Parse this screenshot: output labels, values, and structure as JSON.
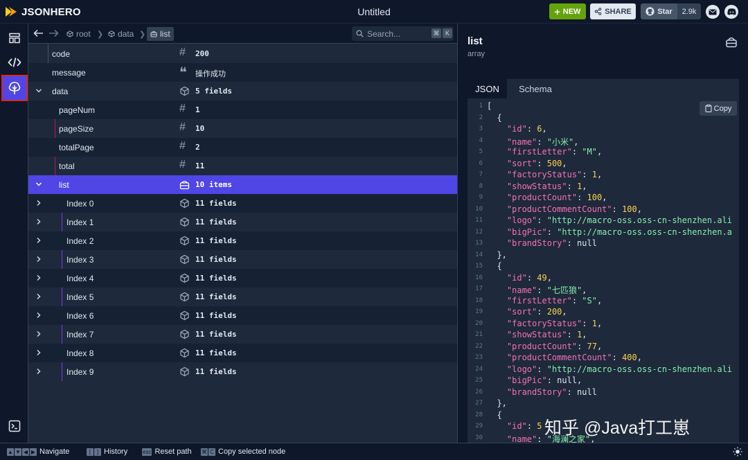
{
  "app": {
    "logo_text": "JSONHERO",
    "document_title": "Untitled",
    "buttons": {
      "new": "NEW",
      "share": "SHARE",
      "star": "Star",
      "star_count": "2.9k"
    }
  },
  "path": {
    "crumbs": [
      {
        "label": "root"
      },
      {
        "label": "data"
      },
      {
        "label": "list"
      }
    ],
    "search_placeholder": "Search...",
    "search_keys": [
      "⌘",
      "K"
    ]
  },
  "tree": {
    "rows": [
      {
        "key": "code",
        "type": "number",
        "value": "200"
      },
      {
        "key": "message",
        "type": "string",
        "value": "操作成功"
      },
      {
        "key": "data",
        "type": "object",
        "value": "5 fields",
        "expanded": true
      },
      {
        "key": "pageNum",
        "type": "number",
        "value": "1"
      },
      {
        "key": "pageSize",
        "type": "number",
        "value": "10"
      },
      {
        "key": "totalPage",
        "type": "number",
        "value": "2"
      },
      {
        "key": "total",
        "type": "number",
        "value": "11"
      },
      {
        "key": "list",
        "type": "array",
        "value": "10 items",
        "expanded": true,
        "selected": true
      },
      {
        "key": "Index 0",
        "type": "object",
        "value": "11 fields"
      },
      {
        "key": "Index 1",
        "type": "object",
        "value": "11 fields"
      },
      {
        "key": "Index 2",
        "type": "object",
        "value": "11 fields"
      },
      {
        "key": "Index 3",
        "type": "object",
        "value": "11 fields"
      },
      {
        "key": "Index 4",
        "type": "object",
        "value": "11 fields"
      },
      {
        "key": "Index 5",
        "type": "object",
        "value": "11 fields"
      },
      {
        "key": "Index 6",
        "type": "object",
        "value": "11 fields"
      },
      {
        "key": "Index 7",
        "type": "object",
        "value": "11 fields"
      },
      {
        "key": "Index 8",
        "type": "object",
        "value": "11 fields"
      },
      {
        "key": "Index 9",
        "type": "object",
        "value": "11 fields"
      }
    ]
  },
  "panel": {
    "title": "list",
    "subtitle": "array",
    "tabs": [
      "JSON",
      "Schema"
    ],
    "copy_label": "Copy",
    "code_lines": [
      [
        [
          "nl",
          "["
        ]
      ],
      [
        [
          "nl",
          "  {"
        ]
      ],
      [
        [
          "nl",
          "    "
        ],
        [
          "k",
          "\"id\""
        ],
        [
          "nl",
          ": "
        ],
        [
          "n",
          "6"
        ],
        [
          "nl",
          ","
        ]
      ],
      [
        [
          "nl",
          "    "
        ],
        [
          "k",
          "\"name\""
        ],
        [
          "nl",
          ": "
        ],
        [
          "s",
          "\"小米\""
        ],
        [
          "nl",
          ","
        ]
      ],
      [
        [
          "nl",
          "    "
        ],
        [
          "k",
          "\"firstLetter\""
        ],
        [
          "nl",
          ": "
        ],
        [
          "s",
          "\"M\""
        ],
        [
          "nl",
          ","
        ]
      ],
      [
        [
          "nl",
          "    "
        ],
        [
          "k",
          "\"sort\""
        ],
        [
          "nl",
          ": "
        ],
        [
          "n",
          "500"
        ],
        [
          "nl",
          ","
        ]
      ],
      [
        [
          "nl",
          "    "
        ],
        [
          "k",
          "\"factoryStatus\""
        ],
        [
          "nl",
          ": "
        ],
        [
          "n",
          "1"
        ],
        [
          "nl",
          ","
        ]
      ],
      [
        [
          "nl",
          "    "
        ],
        [
          "k",
          "\"showStatus\""
        ],
        [
          "nl",
          ": "
        ],
        [
          "n",
          "1"
        ],
        [
          "nl",
          ","
        ]
      ],
      [
        [
          "nl",
          "    "
        ],
        [
          "k",
          "\"productCount\""
        ],
        [
          "nl",
          ": "
        ],
        [
          "n",
          "100"
        ],
        [
          "nl",
          ","
        ]
      ],
      [
        [
          "nl",
          "    "
        ],
        [
          "k",
          "\"productCommentCount\""
        ],
        [
          "nl",
          ": "
        ],
        [
          "n",
          "100"
        ],
        [
          "nl",
          ","
        ]
      ],
      [
        [
          "nl",
          "    "
        ],
        [
          "k",
          "\"logo\""
        ],
        [
          "nl",
          ": "
        ],
        [
          "s",
          "\"http://macro-oss.oss-cn-shenzhen.ali"
        ]
      ],
      [
        [
          "nl",
          "    "
        ],
        [
          "k",
          "\"bigPic\""
        ],
        [
          "nl",
          ": "
        ],
        [
          "s",
          "\"http://macro-oss.oss-cn-shenzhen.a"
        ]
      ],
      [
        [
          "nl",
          "    "
        ],
        [
          "k",
          "\"brandStory\""
        ],
        [
          "nl",
          ": null"
        ]
      ],
      [
        [
          "nl",
          "  },"
        ]
      ],
      [
        [
          "nl",
          "  {"
        ]
      ],
      [
        [
          "nl",
          "    "
        ],
        [
          "k",
          "\"id\""
        ],
        [
          "nl",
          ": "
        ],
        [
          "n",
          "49"
        ],
        [
          "nl",
          ","
        ]
      ],
      [
        [
          "nl",
          "    "
        ],
        [
          "k",
          "\"name\""
        ],
        [
          "nl",
          ": "
        ],
        [
          "s",
          "\"七匹狼\""
        ],
        [
          "nl",
          ","
        ]
      ],
      [
        [
          "nl",
          "    "
        ],
        [
          "k",
          "\"firstLetter\""
        ],
        [
          "nl",
          ": "
        ],
        [
          "s",
          "\"S\""
        ],
        [
          "nl",
          ","
        ]
      ],
      [
        [
          "nl",
          "    "
        ],
        [
          "k",
          "\"sort\""
        ],
        [
          "nl",
          ": "
        ],
        [
          "n",
          "200"
        ],
        [
          "nl",
          ","
        ]
      ],
      [
        [
          "nl",
          "    "
        ],
        [
          "k",
          "\"factoryStatus\""
        ],
        [
          "nl",
          ": "
        ],
        [
          "n",
          "1"
        ],
        [
          "nl",
          ","
        ]
      ],
      [
        [
          "nl",
          "    "
        ],
        [
          "k",
          "\"showStatus\""
        ],
        [
          "nl",
          ": "
        ],
        [
          "n",
          "1"
        ],
        [
          "nl",
          ","
        ]
      ],
      [
        [
          "nl",
          "    "
        ],
        [
          "k",
          "\"productCount\""
        ],
        [
          "nl",
          ": "
        ],
        [
          "n",
          "77"
        ],
        [
          "nl",
          ","
        ]
      ],
      [
        [
          "nl",
          "    "
        ],
        [
          "k",
          "\"productCommentCount\""
        ],
        [
          "nl",
          ": "
        ],
        [
          "n",
          "400"
        ],
        [
          "nl",
          ","
        ]
      ],
      [
        [
          "nl",
          "    "
        ],
        [
          "k",
          "\"logo\""
        ],
        [
          "nl",
          ": "
        ],
        [
          "s",
          "\"http://macro-oss.oss-cn-shenzhen.ali"
        ]
      ],
      [
        [
          "nl",
          "    "
        ],
        [
          "k",
          "\"bigPic\""
        ],
        [
          "nl",
          ": null,"
        ]
      ],
      [
        [
          "nl",
          "    "
        ],
        [
          "k",
          "\"brandStory\""
        ],
        [
          "nl",
          ": null"
        ]
      ],
      [
        [
          "nl",
          "  },"
        ]
      ],
      [
        [
          "nl",
          "  {"
        ]
      ],
      [
        [
          "nl",
          "    "
        ],
        [
          "k",
          "\"id\""
        ],
        [
          "nl",
          ": "
        ],
        [
          "n",
          "5"
        ]
      ],
      [
        [
          "nl",
          "    "
        ],
        [
          "k",
          "\"name\""
        ],
        [
          "nl",
          ": "
        ],
        [
          "s",
          "\"海澜之家\""
        ],
        [
          "nl",
          ","
        ]
      ]
    ]
  },
  "status_bar": {
    "hints": [
      {
        "keys": [
          "▲",
          "▼",
          "◀",
          "▶"
        ],
        "label": "Navigate"
      },
      {
        "keys": [
          "[",
          "]"
        ],
        "label": "History"
      },
      {
        "keys": [
          "esc"
        ],
        "label": "Reset path"
      },
      {
        "keys": [
          "⌘",
          "C"
        ],
        "label": "Copy selected node"
      }
    ]
  },
  "watermark": {
    "text": "知乎 @Java打工崽"
  },
  "colors": {
    "accent": "#4f46e5",
    "new_button": "#65a30d",
    "highlight_border": "#dc2626"
  }
}
